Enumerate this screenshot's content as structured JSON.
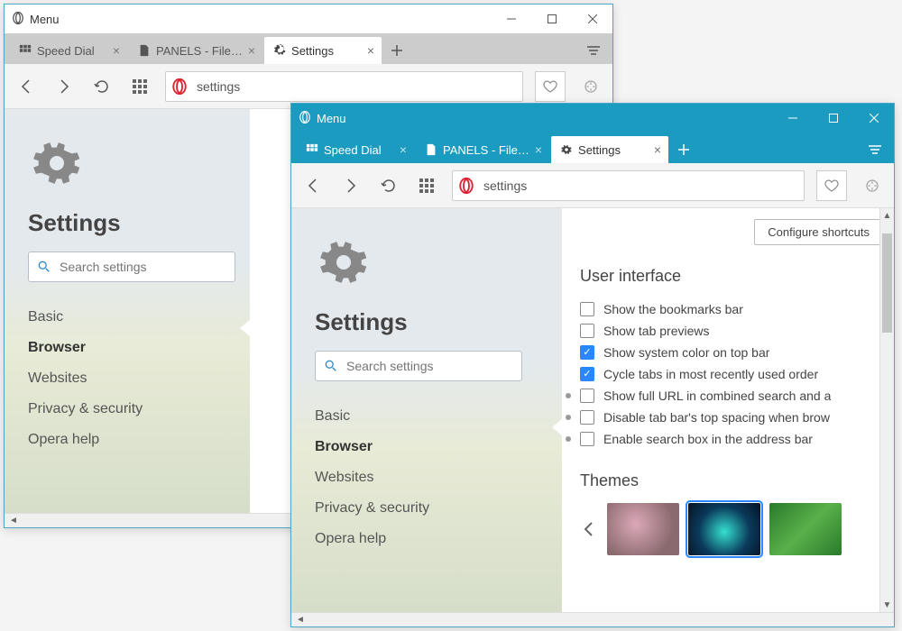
{
  "windows": {
    "a": {
      "title": "Menu",
      "tabs": [
        {
          "label": "Speed Dial"
        },
        {
          "label": "PANELS - File…"
        },
        {
          "label": "Settings"
        }
      ],
      "address": "settings",
      "sidebar": {
        "title": "Settings",
        "search_placeholder": "Search settings",
        "nav": [
          "Basic",
          "Browser",
          "Websites",
          "Privacy & security",
          "Opera help"
        ]
      }
    },
    "b": {
      "title": "Menu",
      "tabs": [
        {
          "label": "Speed Dial"
        },
        {
          "label": "PANELS - File…"
        },
        {
          "label": "Settings"
        }
      ],
      "address": "settings",
      "sidebar": {
        "title": "Settings",
        "search_placeholder": "Search settings",
        "nav": [
          "Basic",
          "Browser",
          "Websites",
          "Privacy & security",
          "Opera help"
        ]
      },
      "panel": {
        "configure_label": "Configure shortcuts",
        "section_ui": "User interface",
        "opts": [
          {
            "label": "Show the bookmarks bar",
            "checked": false
          },
          {
            "label": "Show tab previews",
            "checked": false
          },
          {
            "label": "Show system color on top bar",
            "checked": true
          },
          {
            "label": "Cycle tabs in most recently used order",
            "checked": true
          },
          {
            "label": "Show full URL in combined search and a",
            "checked": false,
            "adv": true
          },
          {
            "label": "Disable tab bar's top spacing when brow",
            "checked": false,
            "adv": true
          },
          {
            "label": "Enable search box in the address bar",
            "checked": false,
            "adv": true
          }
        ],
        "section_themes": "Themes"
      }
    }
  }
}
